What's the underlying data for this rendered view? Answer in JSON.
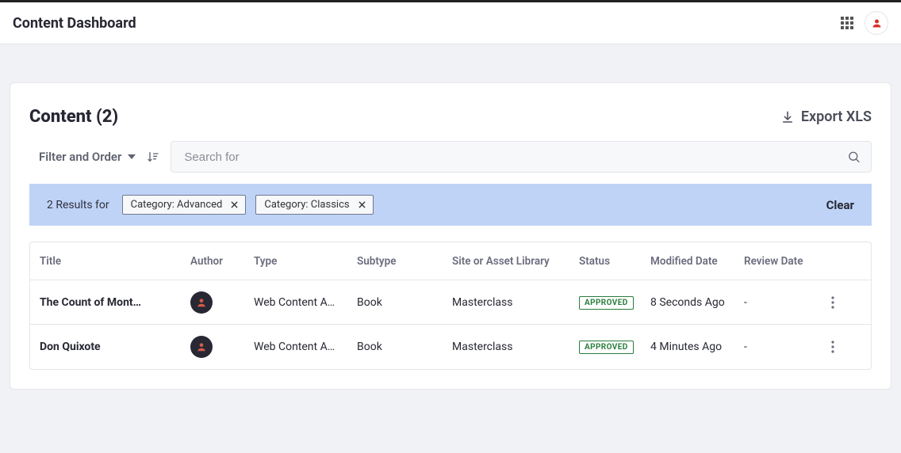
{
  "topbar": {
    "title": "Content Dashboard"
  },
  "card": {
    "title": "Content (2)",
    "export_label": "Export XLS"
  },
  "toolbar": {
    "filter_order_label": "Filter and Order"
  },
  "search": {
    "placeholder": "Search for"
  },
  "filters": {
    "results_label": "2 Results for",
    "chips": [
      {
        "label": "Category: Advanced"
      },
      {
        "label": "Category: Classics"
      }
    ],
    "clear_label": "Clear"
  },
  "table": {
    "columns": [
      "Title",
      "Author",
      "Type",
      "Subtype",
      "Site or Asset Library",
      "Status",
      "Modified Date",
      "Review Date"
    ],
    "rows": [
      {
        "title": "The Count of Mont…",
        "type": "Web Content A…",
        "subtype": "Book",
        "site": "Masterclass",
        "status": "APPROVED",
        "modified": "8 Seconds Ago",
        "review": "-"
      },
      {
        "title": "Don Quixote",
        "type": "Web Content A…",
        "subtype": "Book",
        "site": "Masterclass",
        "status": "APPROVED",
        "modified": "4 Minutes Ago",
        "review": "-"
      }
    ]
  }
}
